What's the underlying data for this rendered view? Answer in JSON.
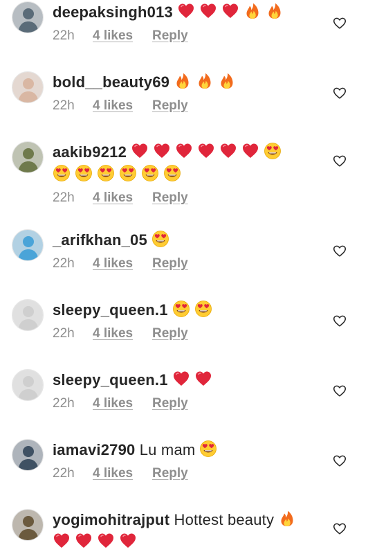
{
  "comments": [
    {
      "username": "deepaksingh013",
      "text": "",
      "emojis": [
        "heart",
        "heart",
        "heart",
        "fire",
        "fire"
      ],
      "emojis2": [],
      "time": "22h",
      "likes": "4 likes",
      "reply": "Reply",
      "avatar_color": "#5a6b78"
    },
    {
      "username": "bold__beauty69",
      "text": "",
      "emojis": [
        "fire",
        "fire",
        "fire"
      ],
      "emojis2": [],
      "time": "22h",
      "likes": "4 likes",
      "reply": "Reply",
      "avatar_color": "#d9b7a3"
    },
    {
      "username": "aakib9212",
      "text": "",
      "emojis": [
        "heart",
        "heart",
        "heart",
        "heart",
        "heart",
        "heart",
        "hearteyes"
      ],
      "emojis2": [
        "hearteyes",
        "hearteyes",
        "hearteyes",
        "hearteyes",
        "hearteyes",
        "hearteyes"
      ],
      "time": "22h",
      "likes": "4 likes",
      "reply": "Reply",
      "avatar_color": "#6f7a4c"
    },
    {
      "username": "_arifkhan_05",
      "text": "",
      "emojis": [
        "hearteyes"
      ],
      "emojis2": [],
      "time": "22h",
      "likes": "4 likes",
      "reply": "Reply",
      "avatar_color": "#4aa4d8"
    },
    {
      "username": "sleepy_queen.1",
      "text": "",
      "emojis": [
        "hearteyes",
        "hearteyes"
      ],
      "emojis2": [],
      "time": "22h",
      "likes": "4 likes",
      "reply": "Reply",
      "avatar_color": "#cfcfcf"
    },
    {
      "username": "sleepy_queen.1",
      "text": "",
      "emojis": [
        "heart",
        "heart"
      ],
      "emojis2": [],
      "time": "22h",
      "likes": "4 likes",
      "reply": "Reply",
      "avatar_color": "#cfcfcf"
    },
    {
      "username": "iamavi2790",
      "text": "Lu mam",
      "emojis": [
        "hearteyes"
      ],
      "emojis2": [],
      "time": "22h",
      "likes": "4 likes",
      "reply": "Reply",
      "avatar_color": "#3f5163"
    },
    {
      "username": "yogimohitrajput",
      "text": "Hottest beauty",
      "emojis": [
        "fire"
      ],
      "emojis2": [
        "heart",
        "heart",
        "heart",
        "heart"
      ],
      "time": "",
      "likes": "",
      "reply": "",
      "avatar_color": "#6b5a3e"
    }
  ],
  "colors": {
    "heart": "#e0263b",
    "fire": "#f26b1d",
    "meta": "#8e8e8e",
    "username": "#262626"
  },
  "icons": {
    "like": "heart-outline-icon"
  }
}
